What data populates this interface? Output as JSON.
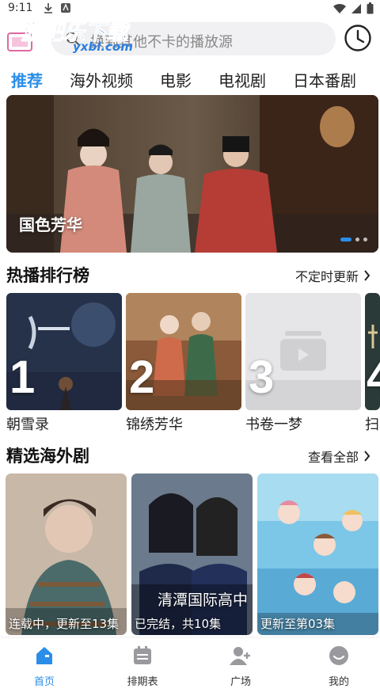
{
  "status_bar": {
    "time": "9:11"
  },
  "header": {
    "logo_text": "游吧乐下载",
    "logo_sub": "yxbl.com",
    "search_placeholder": "换到其他不卡的播放源"
  },
  "tabs": [
    {
      "label": "推荐",
      "active": true
    },
    {
      "label": "海外视频",
      "active": false
    },
    {
      "label": "电影",
      "active": false
    },
    {
      "label": "电视剧",
      "active": false
    },
    {
      "label": "日本番剧",
      "active": false
    }
  ],
  "banner": {
    "title": "国色芳华",
    "slide_count": 3,
    "active_slide": 1
  },
  "ranking": {
    "title": "热播排行榜",
    "more": "不定时更新",
    "items": [
      {
        "rank": "1",
        "name": "朝雪录"
      },
      {
        "rank": "2",
        "name": "锦绣芳华"
      },
      {
        "rank": "3",
        "name": "书卷一梦"
      },
      {
        "rank": "4",
        "name": "扫"
      }
    ]
  },
  "featured": {
    "title": "精选海外剧",
    "more": "查看全部",
    "items": [
      {
        "status": "连载中，更新至13集",
        "overlay_title": ""
      },
      {
        "status": "已完结，共10集",
        "overlay_title": "清潭国际高中"
      },
      {
        "status": "更新至第03集",
        "overlay_title": ""
      }
    ]
  },
  "bottom_nav": [
    {
      "label": "首页",
      "icon": "home-icon",
      "active": true
    },
    {
      "label": "排期表",
      "icon": "schedule-icon",
      "active": false
    },
    {
      "label": "广场",
      "icon": "plaza-icon",
      "active": false
    },
    {
      "label": "我的",
      "icon": "profile-icon",
      "active": false
    }
  ],
  "colors": {
    "accent": "#2a8ee9",
    "search_bg": "#f1f1f3"
  }
}
